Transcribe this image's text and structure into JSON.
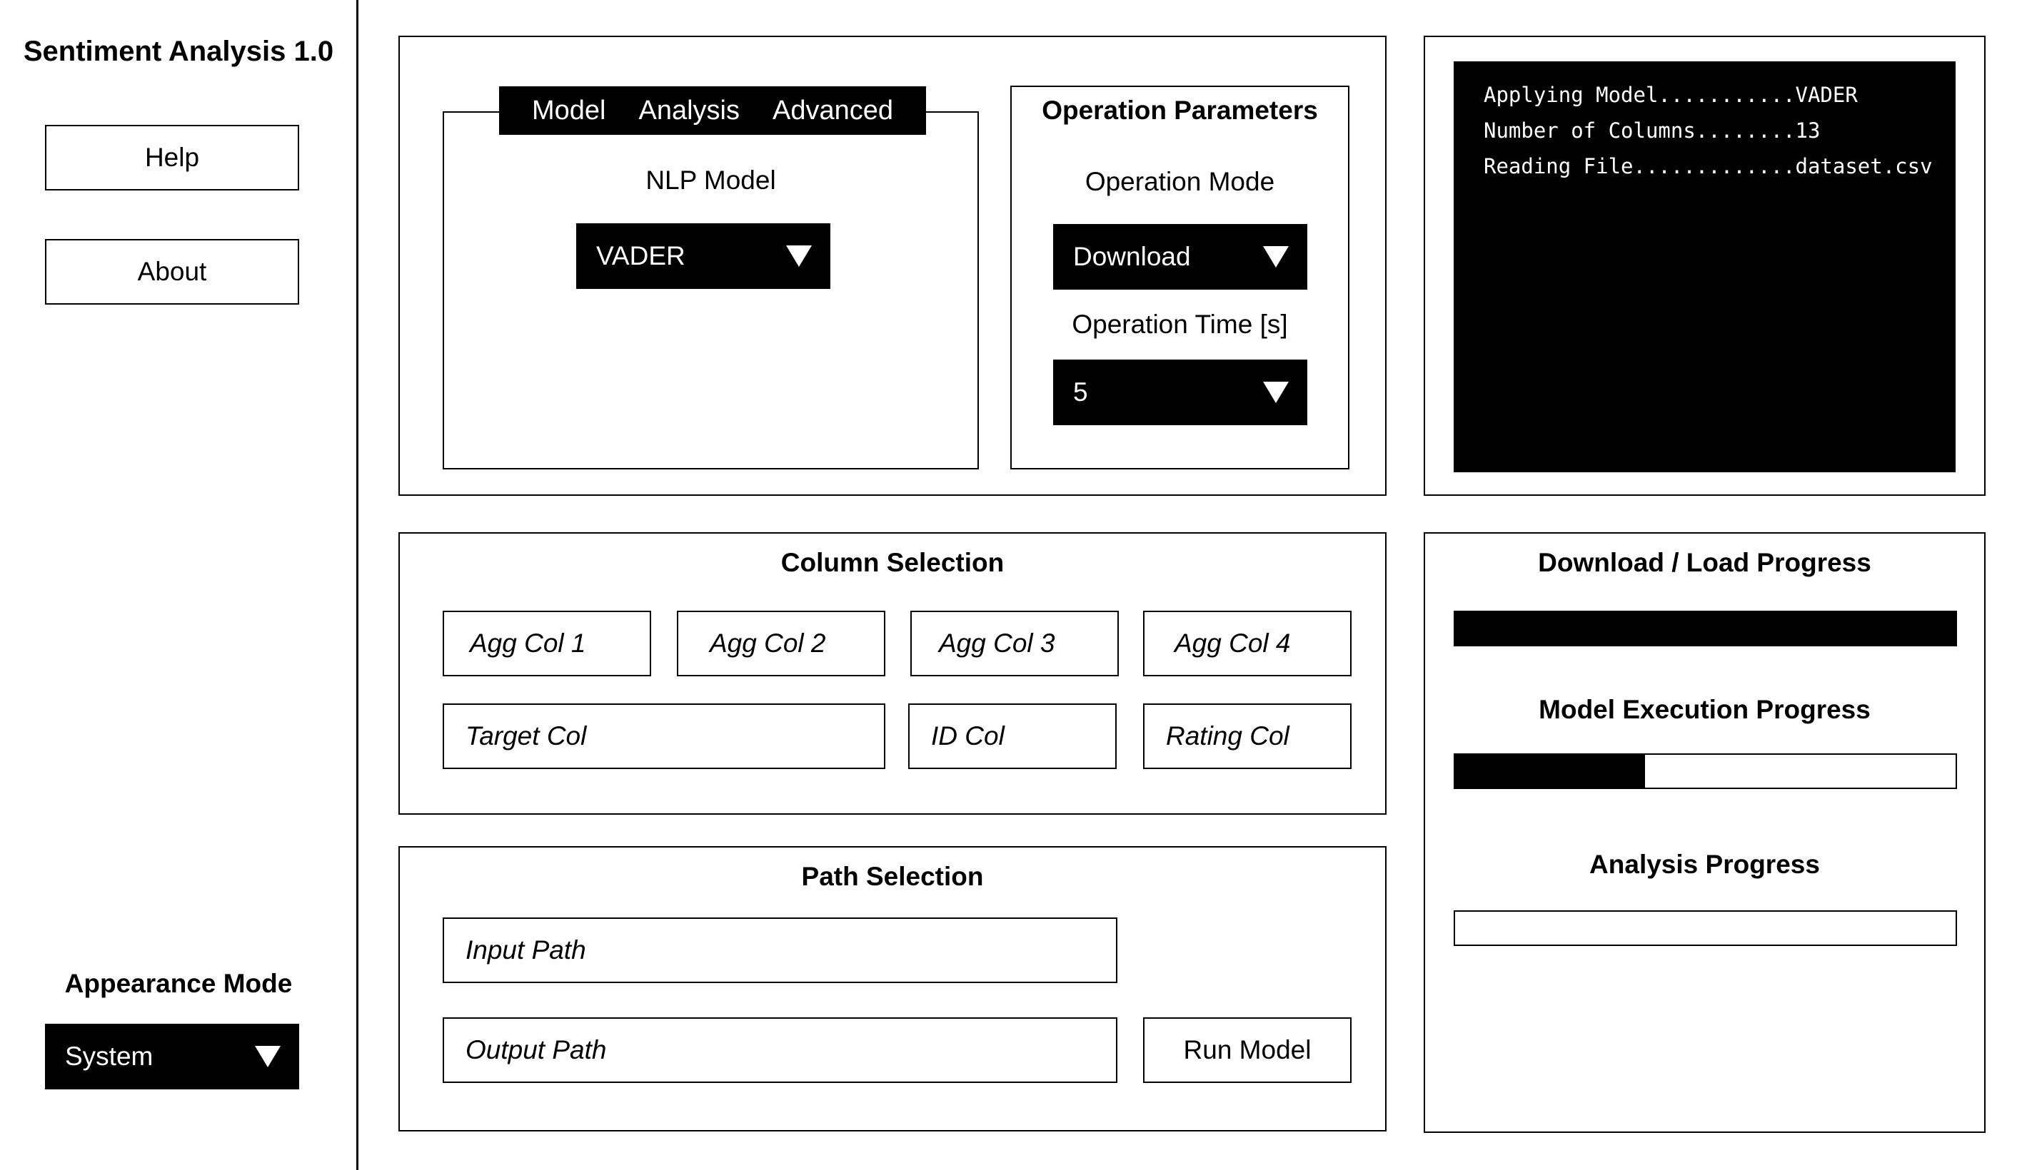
{
  "sidebar": {
    "app_title": "Sentiment Analysis 1.0",
    "help_label": "Help",
    "about_label": "About",
    "appearance_title": "Appearance Mode",
    "appearance_value": "System"
  },
  "model_panel": {
    "tabs": [
      "Model",
      "Analysis",
      "Advanced"
    ],
    "nlp_model_label": "NLP Model",
    "nlp_model_value": "VADER"
  },
  "operation": {
    "title": "Operation Parameters",
    "mode_label": "Operation Mode",
    "mode_value": "Download",
    "time_label": "Operation Time [s]",
    "time_value": "5"
  },
  "console": {
    "lines": [
      "Applying Model...........VADER",
      "Number of Columns........13",
      "Reading File.............dataset.csv"
    ]
  },
  "columns": {
    "title": "Column Selection",
    "agg_col_1": "Agg Col 1",
    "agg_col_2": "Agg Col 2",
    "agg_col_3": "Agg Col 3",
    "agg_col_4": "Agg Col 4",
    "target_col": "Target Col",
    "id_col": "ID Col",
    "rating_col": "Rating Col"
  },
  "paths": {
    "title": "Path Selection",
    "input_placeholder": "Input Path",
    "output_placeholder": "Output Path",
    "run_label": "Run Model"
  },
  "progress": {
    "download_title": "Download / Load Progress",
    "download_value": 1.0,
    "model_title": "Model Execution Progress",
    "model_value": 0.38,
    "analysis_title": "Analysis Progress",
    "analysis_value": 0.0
  },
  "colors": {
    "accent": "#000000",
    "background": "#ffffff"
  }
}
